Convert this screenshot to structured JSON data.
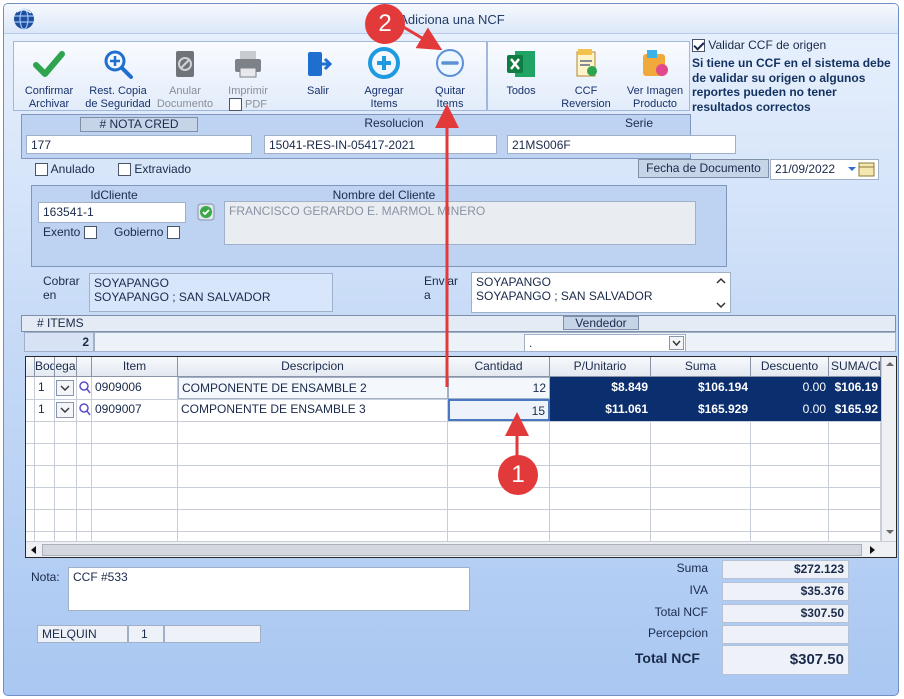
{
  "window": {
    "title": "Adiciona una NCF"
  },
  "toolbar": {
    "confirm": [
      "Confirmar",
      "Archivar"
    ],
    "backup": [
      "Rest. Copia",
      "de Seguridad"
    ],
    "void": [
      "Anular",
      "Documento"
    ],
    "print": "Imprimir",
    "pdf": "PDF",
    "exit": "Salir",
    "add": [
      "Agregar",
      "Items"
    ],
    "remove": [
      "Quitar",
      "Items"
    ],
    "all": "Todos",
    "ccf": [
      "CCF",
      "Reversion"
    ],
    "image": [
      "Ver Imagen",
      "Producto"
    ]
  },
  "validate": {
    "label": "Validar CCF de origen",
    "checked": true,
    "note": "Si tiene un CCF en el sistema debe de validar su origen o algunos reportes pueden no tener resultados correctos"
  },
  "header": {
    "nota_label": "# NOTA CRED",
    "nota_value": "177",
    "resolucion_label": "Resolucion",
    "resolucion_value": "15041-RES-IN-05417-2021",
    "serie_label": "Serie",
    "serie_value": "21MS006F",
    "anulado": "Anulado",
    "extraviado": "Extraviado",
    "fecha_label": "Fecha de  Documento",
    "fecha_value": "21/09/2022"
  },
  "client": {
    "id_label": "IdCliente",
    "id_value": "163541-1",
    "name_label": "Nombre del Cliente",
    "name_value": "FRANCISCO GERARDO E. MARMOL MINERO",
    "exento": "Exento",
    "gobierno": "Gobierno"
  },
  "address": {
    "cobrar_label": [
      "Cobrar",
      "en"
    ],
    "cobrar_lines": [
      "SOYAPANGO",
      "SOYAPANGO ; SAN SALVADOR"
    ],
    "enviar_label": [
      "Enviar",
      "a"
    ],
    "enviar_lines": [
      "SOYAPANGO",
      "SOYAPANGO ; SAN SALVADOR"
    ]
  },
  "items_bar": {
    "items_label": "# ITEMS",
    "items_count": "2",
    "vendedor_label": "Vendedor",
    "vendedor_value": "."
  },
  "grid": {
    "columns": [
      "Bod",
      "ega",
      "Item",
      "Descripcion",
      "Cantidad",
      "P/Unitario",
      "Suma",
      "Descuento",
      "SUMA/CD"
    ],
    "rows": [
      {
        "bod": "1",
        "item": "0909006",
        "desc": "COMPONENTE DE ENSAMBLE 2",
        "cant": "12",
        "punit": "$8.849",
        "suma": "$106.194",
        "desc_amt": "0.00",
        "sumacd": "$106.19"
      },
      {
        "bod": "1",
        "item": "0909007",
        "desc": "COMPONENTE DE ENSAMBLE 3",
        "cant": "15",
        "punit": "$11.061",
        "suma": "$165.929",
        "desc_amt": "0.00",
        "sumacd": "$165.92"
      }
    ]
  },
  "nota": {
    "label": "Nota:",
    "value": "CCF  #533"
  },
  "footer": {
    "user": "MELQUIN",
    "num": "1",
    "extra": ""
  },
  "totals": {
    "suma_label": "Suma",
    "suma": "$272.123",
    "iva_label": "IVA",
    "iva": "$35.376",
    "total_label": "Total NCF",
    "total": "$307.50",
    "percepcion_label": "Percepcion",
    "percepcion": "",
    "grand_label": "Total NCF",
    "grand": "$307.50"
  },
  "annotations": {
    "one": "1",
    "two": "2"
  },
  "colors": {
    "selected_row": "#0b2f6e",
    "arrow": "#e23a3a",
    "accent": "#1f6fd1"
  }
}
